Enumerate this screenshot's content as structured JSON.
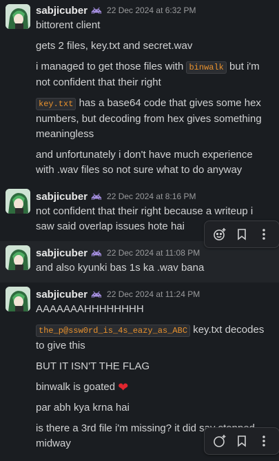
{
  "messages": [
    {
      "author": "sabjicuber",
      "time": "22 Dec 2024 at 6:32 PM",
      "paragraphs": {
        "p0": "bittorent client",
        "p1": "gets 2 files, key.txt and secret.wav",
        "p2_pre": "i managed to get those files with ",
        "p2_code": "binwalk",
        "p2_post": " but i'm not confident that their right",
        "p3_code": "key.txt",
        "p3_post": " has a base64 code that gives some hex numbers, but decoding from hex gives something meaningless",
        "p4": "and unfortunately i don't have much experience with .wav files so not sure what to do anyway"
      }
    },
    {
      "author": "sabjicuber",
      "time": "22 Dec 2024 at 8:16 PM",
      "text": "not confident that their right because a writeup i saw said overlap issues hote hai"
    },
    {
      "author": "sabjicuber",
      "time": "22 Dec 2024 at 11:08 PM",
      "text": "and also kyunki bas 1s ka .wav bana"
    },
    {
      "author": "sabjicuber",
      "time": "22 Dec 2024 at 11:24 PM",
      "paragraphs": {
        "p0": "AAAAAAAHHHHHHHH",
        "p1_code": "the_p@ssw0rd_is_4s_eazy_as_ABC",
        "p1_post": " key.txt decodes to give this",
        "p2": "BUT IT ISN'T THE FLAG",
        "p3": "binwalk is goated",
        "p3_emoji": "❤",
        "p4": "par abh kya krna hai",
        "p5": "is there a 3rd file i'm missing? it did say stopped midway"
      }
    }
  ],
  "icons": {
    "badge": "space-invader-icon",
    "react": "add-reaction-icon",
    "save": "bookmark-icon",
    "more": "more-vertical-icon"
  },
  "colors": {
    "background": "#1a1d21",
    "code_text": "#e8912d",
    "badge": "#a58fe0",
    "heart": "#e0262f"
  }
}
